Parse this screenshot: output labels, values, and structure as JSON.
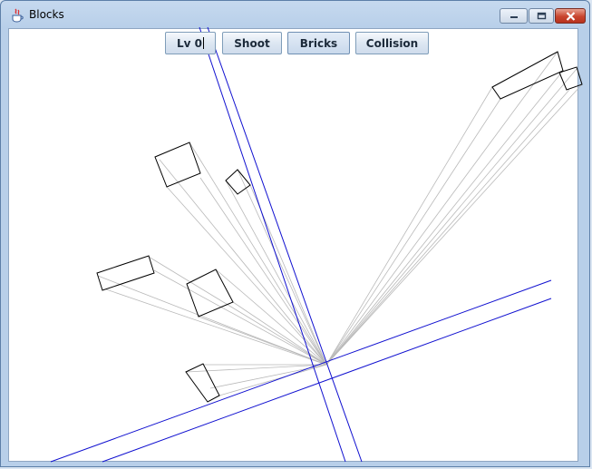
{
  "window": {
    "title": "Blocks",
    "icon": "java-cup-icon"
  },
  "toolbar": {
    "level_value": "Lv 0",
    "shoot_label": "Shoot",
    "bricks_label": "Bricks",
    "collision_label": "Collision"
  },
  "colors": {
    "beam": "#1010d0",
    "brick_outline": "#000000",
    "ray": "#b4b4b4",
    "close_button": "#c8452e"
  }
}
